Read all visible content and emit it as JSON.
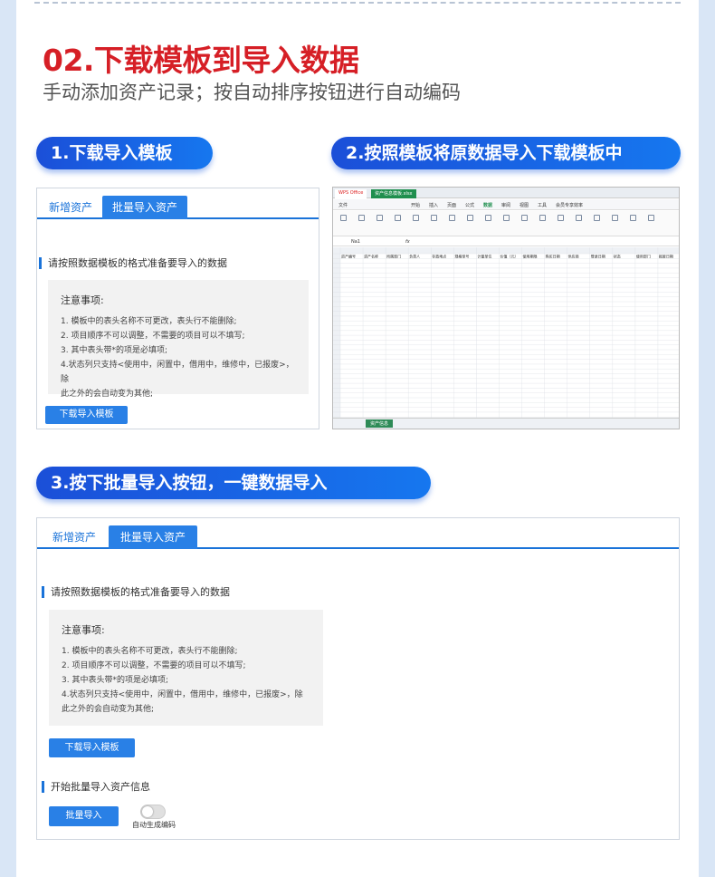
{
  "heading": {
    "title": "02.下载模板到导入数据",
    "subtitle": "手动添加资产记录；按自动排序按钮进行自动编码"
  },
  "steps": [
    {
      "label": "1.下载导入模板"
    },
    {
      "label": "2.按照模板将原数据导入下载模板中"
    },
    {
      "label": "3.按下批量导入按钮，一键数据导入"
    }
  ],
  "panel": {
    "tab_add": "新增资产",
    "tab_batch": "批量导入资产",
    "section_prepare": "请按照数据模板的格式准备要导入的数据",
    "notes_title": "注意事项:",
    "notes": [
      "1. 模板中的表头名称不可更改，表头行不能删除;",
      "2. 项目顺序不可以调整，不需要的项目可以不填写;",
      "3. 其中表头带*的项是必填项;",
      "4.状态列只支持<使用中，闲置中，借用中，维修中，已报废>，除",
      "此之外的会自动变为其他;"
    ],
    "download_button": "下载导入模板",
    "section_start": "开始批量导入资产信息",
    "import_button": "批量导入",
    "auto_code_label": "自动生成编码"
  },
  "spreadsheet": {
    "app_tab": "WPS Office",
    "file_tab": "资产信息模板.xlsx",
    "menu": [
      "文件",
      "开始",
      "插入",
      "页面",
      "公式",
      "数据",
      "审阅",
      "视图",
      "工具",
      "会员专享",
      "效率"
    ],
    "cell_ref": "Na1",
    "fx": "fx",
    "columns": [
      "资产编号",
      "资产名称",
      "所属部门",
      "负责人",
      "存放地点",
      "规格型号",
      "计量单位",
      "价值（元）",
      "使用期限",
      "购买日期",
      "供应商",
      "登录日期",
      "状态",
      "使用部门",
      "报废日期"
    ],
    "sheet_tab": "资产信息"
  }
}
